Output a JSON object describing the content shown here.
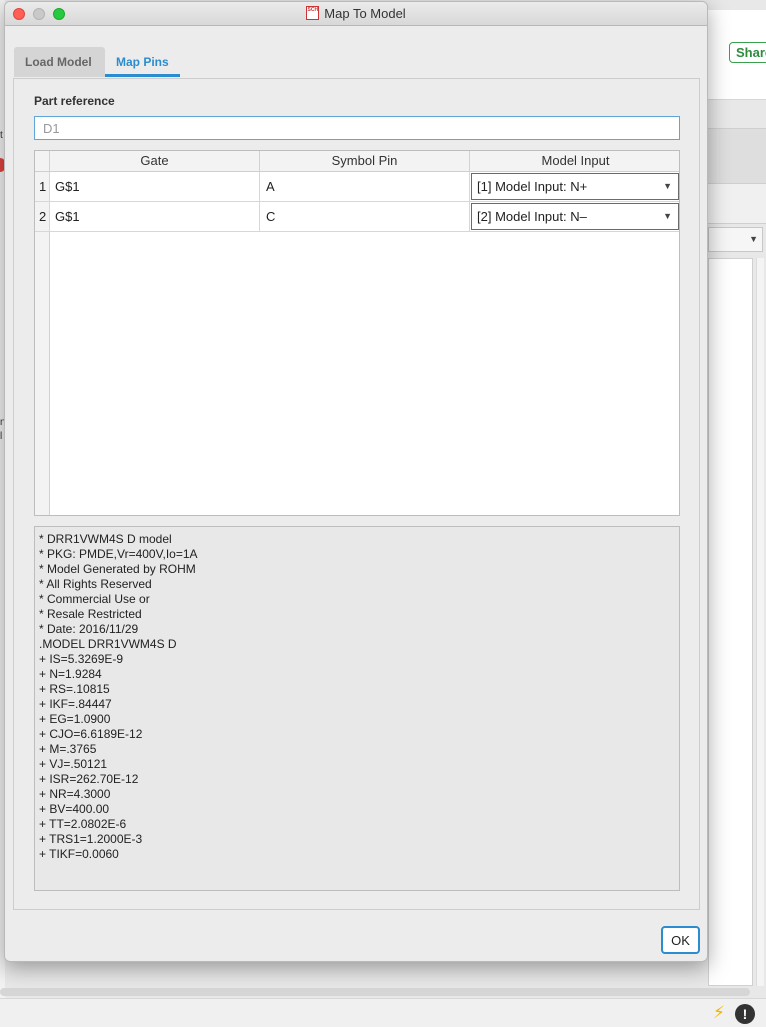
{
  "background": {
    "share_label": "Share",
    "left_marks": [
      "t",
      "n",
      "l"
    ]
  },
  "window": {
    "title": "Map To Model",
    "app_icon_text": "SCH"
  },
  "tabs": [
    {
      "label": "Load Model",
      "active": false
    },
    {
      "label": "Map Pins",
      "active": true
    }
  ],
  "part_reference": {
    "label": "Part reference",
    "value": "D1"
  },
  "table": {
    "columns": [
      "Gate",
      "Symbol Pin",
      "Model Input"
    ],
    "rows": [
      {
        "num": "1",
        "gate": "G$1",
        "pin": "A",
        "model_input": "[1] Model Input: N+"
      },
      {
        "num": "2",
        "gate": "G$1",
        "pin": "C",
        "model_input": "[2] Model Input: N–"
      }
    ]
  },
  "model_text": [
    "* DRR1VWM4S D model",
    "* PKG: PMDE,Vr=400V,Io=1A",
    "* Model Generated by ROHM",
    "* All Rights Reserved",
    "* Commercial Use or",
    "* Resale Restricted",
    "* Date: 2016/11/29",
    ".MODEL DRR1VWM4S D",
    "+ IS=5.3269E-9",
    "+ N=1.9284",
    "+ RS=.10815",
    "+ IKF=.84447",
    "+ EG=1.0900",
    "+ CJO=6.6189E-12",
    "+ M=.3765",
    "+ VJ=.50121",
    "+ ISR=262.70E-12",
    "+ NR=4.3000",
    "+ BV=400.00",
    "+ TT=2.0802E-6",
    "+ TRS1=1.2000E-3",
    "+ TIKF=0.0060"
  ],
  "ok_label": "OK",
  "colors": {
    "accent": "#2b8ccf",
    "close": "#fe5f57",
    "maximize": "#28c840"
  }
}
